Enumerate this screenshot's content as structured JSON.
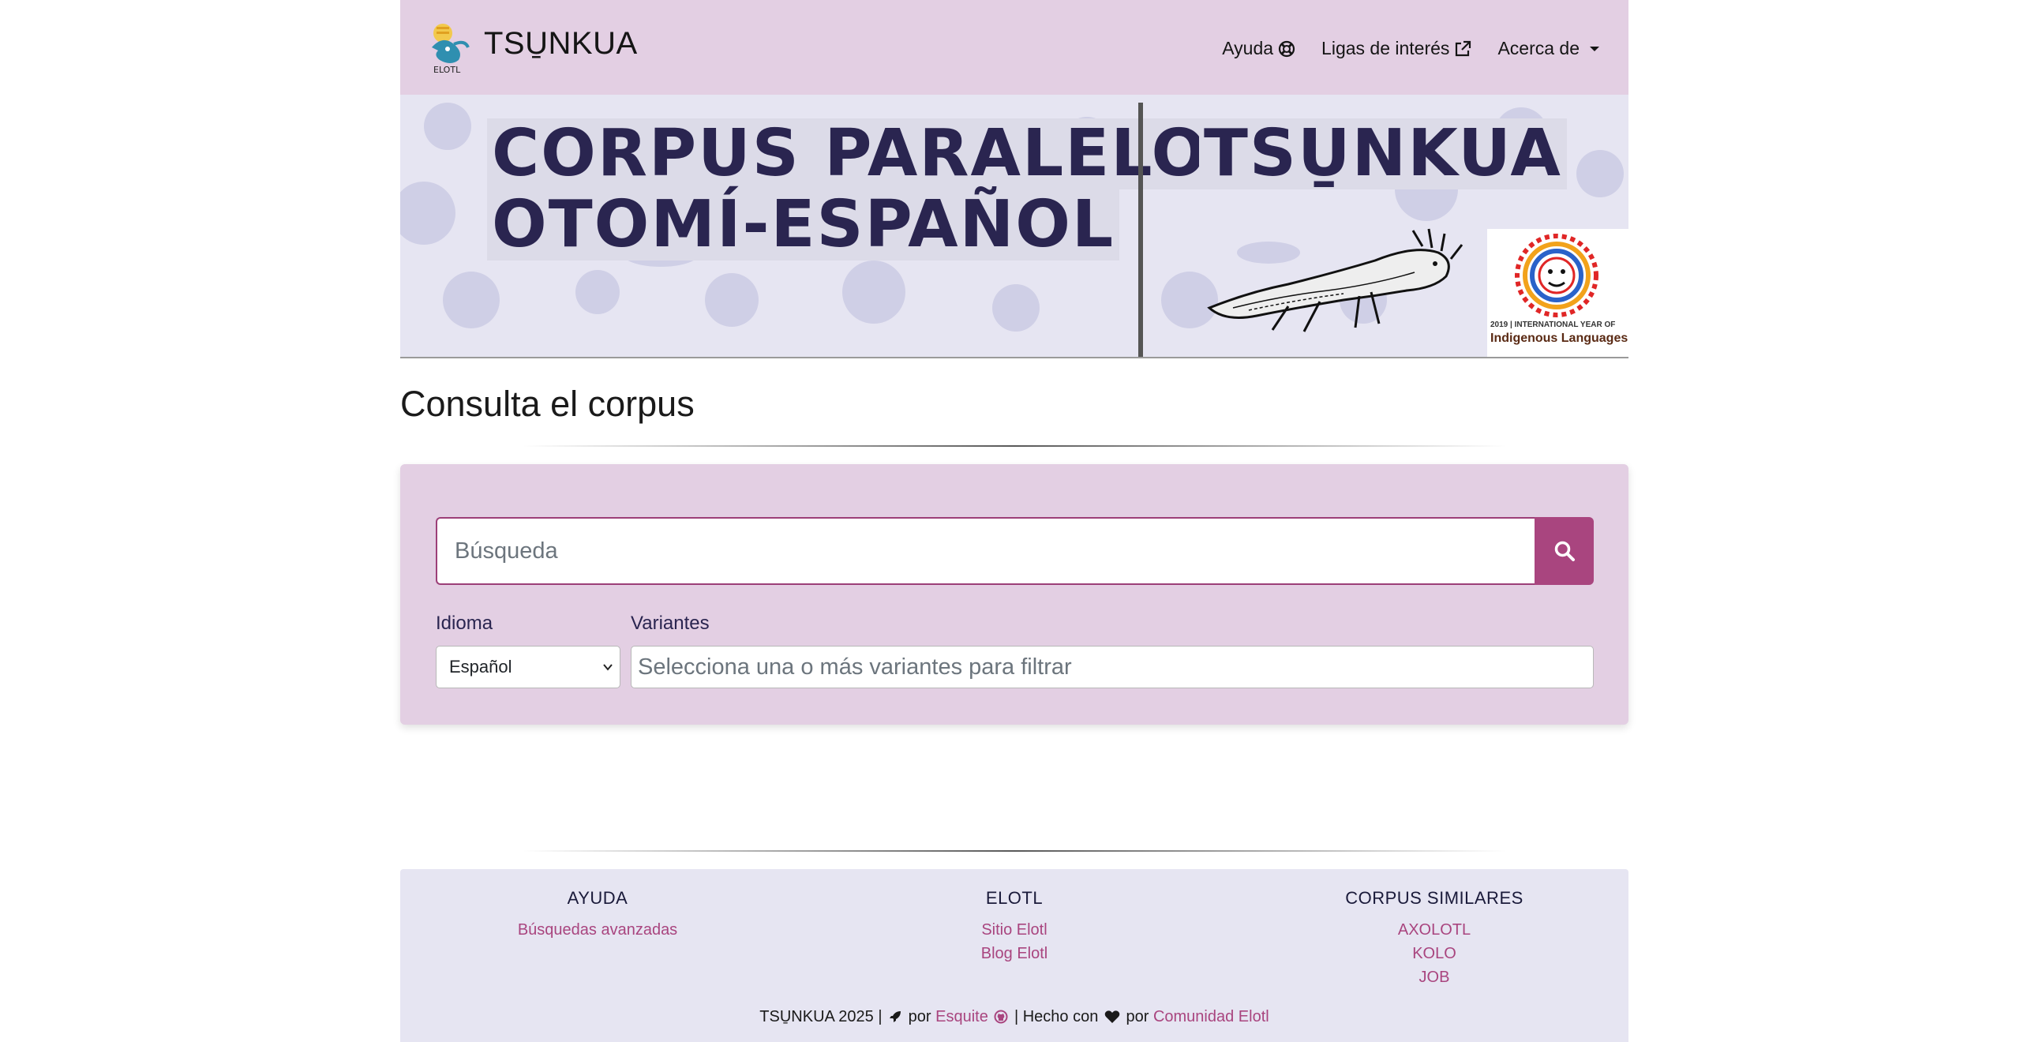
{
  "navbar": {
    "brand_title": "TSU̱NKUA",
    "logo_caption": "ELOTL",
    "links": [
      {
        "label": "Ayuda",
        "icon": "lifebuoy-icon"
      },
      {
        "label": "Ligas de interés",
        "icon": "external-link-icon"
      },
      {
        "label": "Acerca de",
        "icon": "caret-down-icon"
      }
    ]
  },
  "banner": {
    "line1": "CORPUS PARALELO",
    "line2": "OTOMÍ-ESPAÑOL",
    "right_title": "TSU̱NKUA",
    "badge_small": "2019 | INTERNATIONAL YEAR OF",
    "badge_big": "Indigenous Languages"
  },
  "main": {
    "section_title": "Consulta el corpus"
  },
  "search": {
    "placeholder": "Búsqueda",
    "idioma_label": "Idioma",
    "idioma_selected": "Español",
    "variantes_label": "Variantes",
    "variantes_placeholder": "Selecciona una o más variantes para filtrar"
  },
  "footer": {
    "columns": [
      {
        "title": "AYUDA",
        "links": [
          "Búsquedas avanzadas"
        ]
      },
      {
        "title": "ELOTL",
        "links": [
          "Sitio Elotl",
          "Blog Elotl"
        ]
      },
      {
        "title": "CORPUS SIMILARES",
        "links": [
          "AXOLOTL",
          "KOLO",
          "JOB"
        ]
      }
    ],
    "bottom": {
      "prefix": "TSU̱NKUA 2025 |",
      "por1": "por",
      "esquite": "Esquite",
      "sep": "| Hecho con",
      "por2": "por",
      "comunidad": "Comunidad Elotl"
    }
  },
  "colors": {
    "nav_bg": "#e3cfe3",
    "accent": "#a9457f",
    "footer_bg": "#e6e5f2",
    "banner_text": "#2a2550"
  }
}
